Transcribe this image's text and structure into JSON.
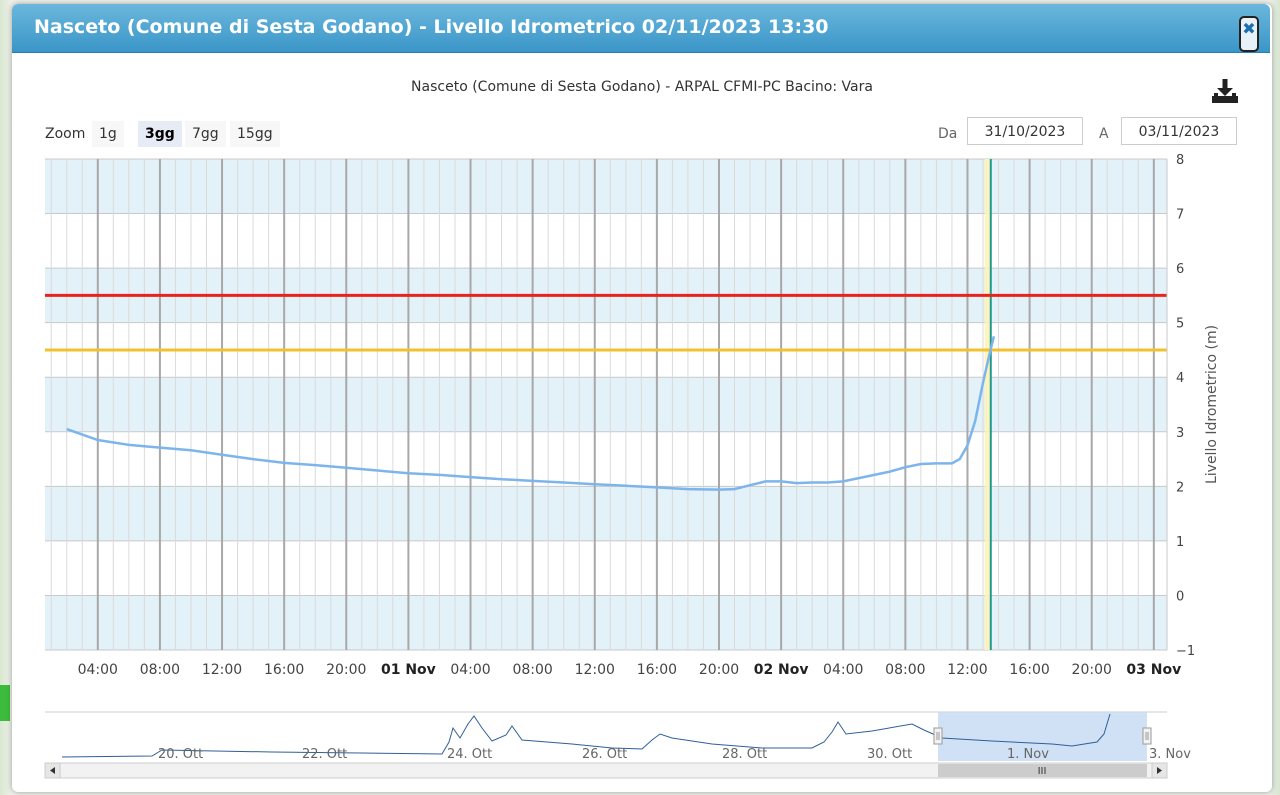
{
  "window": {
    "title": "Nasceto (Comune di Sesta Godano) - Livello Idrometrico 02/11/2023 13:30",
    "close_icon": "close-icon"
  },
  "chart_header": {
    "subtitle": "Nasceto (Comune di Sesta Godano) - ARPAL CFMI-PC Bacino: Vara",
    "download_icon": "download-icon"
  },
  "zoom": {
    "label": "Zoom",
    "options": [
      "1g",
      "3gg",
      "7gg",
      "15gg"
    ],
    "selected": "3gg"
  },
  "range": {
    "from_label": "Da",
    "from_value": "31/10/2023",
    "to_label": "A",
    "to_value": "03/11/2023"
  },
  "chart_data": {
    "type": "line",
    "ylabel": "Livello Idrometrico (m)",
    "ylim": [
      -1,
      8
    ],
    "y_ticks": [
      "8",
      "7",
      "6",
      "5",
      "4",
      "3",
      "2",
      "1",
      "0",
      "−1"
    ],
    "x_ticks": [
      {
        "label": "04:00",
        "h": 2,
        "bold": false
      },
      {
        "label": "08:00",
        "h": 6,
        "bold": false
      },
      {
        "label": "12:00",
        "h": 10,
        "bold": false
      },
      {
        "label": "16:00",
        "h": 14,
        "bold": false
      },
      {
        "label": "20:00",
        "h": 18,
        "bold": false
      },
      {
        "label": "01 Nov",
        "h": 22,
        "bold": true
      },
      {
        "label": "04:00",
        "h": 26,
        "bold": false
      },
      {
        "label": "08:00",
        "h": 30,
        "bold": false
      },
      {
        "label": "12:00",
        "h": 34,
        "bold": false
      },
      {
        "label": "16:00",
        "h": 38,
        "bold": false
      },
      {
        "label": "20:00",
        "h": 42,
        "bold": false
      },
      {
        "label": "02 Nov",
        "h": 46,
        "bold": true
      },
      {
        "label": "04:00",
        "h": 50,
        "bold": false
      },
      {
        "label": "08:00",
        "h": 54,
        "bold": false
      },
      {
        "label": "12:00",
        "h": 58,
        "bold": false
      },
      {
        "label": "16:00",
        "h": 62,
        "bold": false
      },
      {
        "label": "20:00",
        "h": 66,
        "bold": false
      },
      {
        "label": "03 Nov",
        "h": 70,
        "bold": true
      }
    ],
    "thresholds": [
      {
        "value": 5.5,
        "color": "#e8231e"
      },
      {
        "value": 4.5,
        "color": "#f2c12e"
      }
    ],
    "current_time_h": 59.5,
    "series": [
      {
        "color": "#7cb5ec",
        "points": [
          [
            0,
            3.05
          ],
          [
            2,
            2.85
          ],
          [
            4,
            2.76
          ],
          [
            6,
            2.71
          ],
          [
            8,
            2.66
          ],
          [
            10,
            2.58
          ],
          [
            12,
            2.5
          ],
          [
            14,
            2.43
          ],
          [
            16,
            2.39
          ],
          [
            18,
            2.34
          ],
          [
            20,
            2.29
          ],
          [
            22,
            2.24
          ],
          [
            24,
            2.21
          ],
          [
            26,
            2.17
          ],
          [
            28,
            2.13
          ],
          [
            30,
            2.1
          ],
          [
            32,
            2.07
          ],
          [
            34,
            2.04
          ],
          [
            36,
            2.01
          ],
          [
            38,
            1.98
          ],
          [
            40,
            1.95
          ],
          [
            42,
            1.94
          ],
          [
            43,
            1.95
          ],
          [
            44,
            2.02
          ],
          [
            45,
            2.09
          ],
          [
            46,
            2.09
          ],
          [
            47,
            2.06
          ],
          [
            48,
            2.07
          ],
          [
            49,
            2.07
          ],
          [
            50,
            2.09
          ],
          [
            51,
            2.15
          ],
          [
            52,
            2.21
          ],
          [
            53,
            2.27
          ],
          [
            54,
            2.35
          ],
          [
            55,
            2.41
          ],
          [
            56,
            2.42
          ],
          [
            57,
            2.42
          ],
          [
            57.5,
            2.5
          ],
          [
            58,
            2.75
          ],
          [
            58.5,
            3.2
          ],
          [
            59,
            3.9
          ],
          [
            59.4,
            4.4
          ],
          [
            59.7,
            4.75
          ]
        ]
      }
    ]
  },
  "navigator": {
    "labels": [
      "20. Ott",
      "22. Ott",
      "24. Ott",
      "26. Ott",
      "28. Ott",
      "30. Ott",
      "1. Nov",
      "3. Nov"
    ],
    "scroll_grip": "III"
  }
}
